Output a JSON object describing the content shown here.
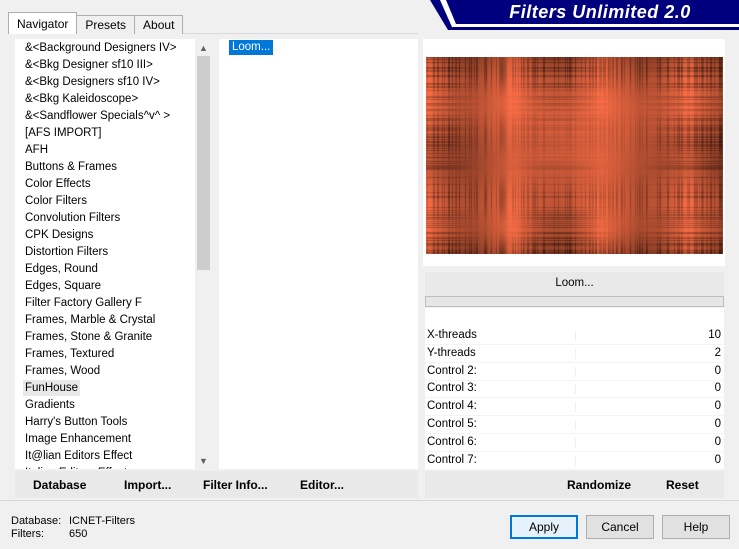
{
  "banner": {
    "title": "Filters Unlimited 2.0"
  },
  "tabs": [
    {
      "label": "Navigator",
      "active": true
    },
    {
      "label": "Presets",
      "active": false
    },
    {
      "label": "About",
      "active": false
    }
  ],
  "categories": {
    "selected": "FunHouse",
    "items": [
      "&<Background Designers IV>",
      "&<Bkg Designer sf10 III>",
      "&<Bkg Designers sf10 IV>",
      "&<Bkg Kaleidoscope>",
      "&<Sandflower Specials^v^ >",
      "[AFS IMPORT]",
      "AFH",
      "Buttons & Frames",
      "Color Effects",
      "Color Filters",
      "Convolution Filters",
      "CPK Designs",
      "Distortion Filters",
      "Edges, Round",
      "Edges, Square",
      "Filter Factory Gallery F",
      "Frames, Marble & Crystal",
      "Frames, Stone & Granite",
      "Frames, Textured",
      "Frames, Wood",
      "FunHouse",
      "Gradients",
      "Harry's Button Tools",
      "Image Enhancement",
      "It@lian Editors Effect",
      "Italian Editors Effect"
    ]
  },
  "filters": {
    "items": [
      "Loom..."
    ],
    "selected": "Loom..."
  },
  "preview": {
    "filter_name": "Loom..."
  },
  "params": [
    {
      "label": "X-threads",
      "value": "10"
    },
    {
      "label": "Y-threads",
      "value": "2"
    },
    {
      "label": "Control 2:",
      "value": "0"
    },
    {
      "label": "Control 3:",
      "value": "0"
    },
    {
      "label": "Control 4:",
      "value": "0"
    },
    {
      "label": "Control 5:",
      "value": "0"
    },
    {
      "label": "Control 6:",
      "value": "0"
    },
    {
      "label": "Control 7:",
      "value": "0"
    }
  ],
  "actions": {
    "database": "Database",
    "import": "Import...",
    "filter_info": "Filter Info...",
    "editor": "Editor...",
    "randomize": "Randomize",
    "reset": "Reset"
  },
  "info": {
    "database_label": "Database:",
    "database_value": "ICNET-Filters",
    "filters_label": "Filters:",
    "filters_value": "650"
  },
  "buttons": {
    "apply": "Apply",
    "cancel": "Cancel",
    "help": "Help"
  },
  "colors": {
    "banner": "#00007e",
    "selection": "#0078d7",
    "accent": "#ff6e48"
  }
}
